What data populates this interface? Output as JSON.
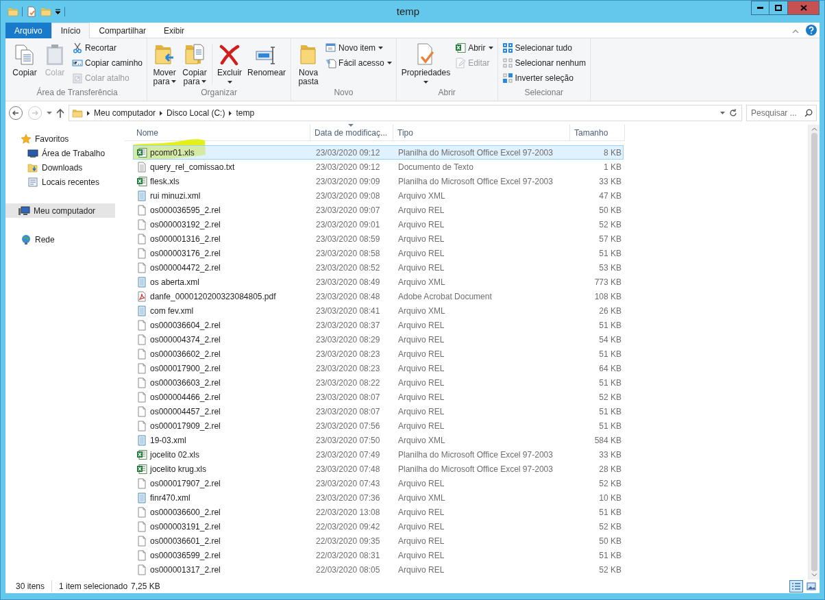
{
  "window": {
    "title": "temp"
  },
  "ribbon_tabs": [
    {
      "label": "Arquivo",
      "kind": "file",
      "selected": false
    },
    {
      "label": "Início",
      "kind": "tab",
      "selected": true
    },
    {
      "label": "Compartilhar",
      "kind": "tab",
      "selected": false
    },
    {
      "label": "Exibir",
      "kind": "tab",
      "selected": false
    }
  ],
  "ribbon_groups": [
    {
      "label": "Área de Transferência",
      "items": [
        {
          "label": "Copiar",
          "kind": "large",
          "disabled": false,
          "dropdown": false
        },
        {
          "label": "Colar",
          "kind": "large",
          "disabled": true,
          "dropdown": false
        },
        {
          "kind": "stack",
          "items": [
            {
              "label": "Recortar",
              "disabled": false,
              "dropdown": false
            },
            {
              "label": "Copiar caminho",
              "disabled": false,
              "dropdown": false
            },
            {
              "label": "Colar atalho",
              "disabled": true,
              "dropdown": false
            }
          ]
        }
      ]
    },
    {
      "label": "Organizar",
      "items": [
        {
          "label": "Mover para",
          "kind": "large",
          "disabled": false,
          "dropdown": true
        },
        {
          "label": "Copiar para",
          "kind": "large",
          "disabled": false,
          "dropdown": true
        },
        {
          "kind": "separator"
        },
        {
          "label": "Excluir",
          "kind": "split",
          "disabled": false,
          "dropdown": true
        },
        {
          "label": "Renomear",
          "kind": "large",
          "disabled": false,
          "dropdown": false
        }
      ]
    },
    {
      "label": "Novo",
      "items": [
        {
          "label": "Nova pasta",
          "kind": "large",
          "disabled": false,
          "dropdown": false
        },
        {
          "kind": "stack",
          "items": [
            {
              "label": "Novo item",
              "disabled": false,
              "dropdown": true
            },
            {
              "label": "Fácil acesso",
              "disabled": false,
              "dropdown": true
            }
          ]
        }
      ]
    },
    {
      "label": "Abrir",
      "items": [
        {
          "label": "Propriedades",
          "kind": "split",
          "disabled": false,
          "dropdown": true
        },
        {
          "kind": "stack",
          "items": [
            {
              "label": "Abrir",
              "disabled": false,
              "dropdown": true
            },
            {
              "label": "Editar",
              "disabled": true,
              "dropdown": false
            }
          ]
        }
      ]
    },
    {
      "label": "Selecionar",
      "items": [
        {
          "kind": "stack",
          "items": [
            {
              "label": "Selecionar tudo",
              "disabled": false,
              "dropdown": false
            },
            {
              "label": "Selecionar nenhum",
              "disabled": false,
              "dropdown": false
            },
            {
              "label": "Inverter seleção",
              "disabled": false,
              "dropdown": false
            }
          ]
        }
      ]
    }
  ],
  "address": {
    "breadcrumb": [
      "Meu computador",
      "Disco Local (C:)",
      "temp"
    ],
    "back_disabled": false,
    "forward_disabled": true
  },
  "search": {
    "placeholder": "Pesquisar ..."
  },
  "sidebar": {
    "items": [
      {
        "label": "Favoritos",
        "kind": "favorites",
        "selected": false,
        "children": [
          {
            "label": "Área de Trabalho",
            "kind": "desktop",
            "selected": false
          },
          {
            "label": "Downloads",
            "kind": "downloads",
            "selected": false
          },
          {
            "label": "Locais recentes",
            "kind": "recent",
            "selected": false
          }
        ]
      },
      {
        "label": "Meu computador",
        "kind": "computer",
        "selected": true
      },
      {
        "label": "Rede",
        "kind": "network",
        "selected": false
      }
    ]
  },
  "table": {
    "columns": [
      {
        "label": "Nome",
        "sorted": false
      },
      {
        "label": "Data de modificaç...",
        "sorted": true
      },
      {
        "label": "Tipo",
        "sorted": false
      },
      {
        "label": "Tamanho",
        "sorted": false
      }
    ],
    "rows": [
      {
        "name": "pcomr01.xls",
        "date": "23/03/2020 09:12",
        "type": "Planilha do Microsoft Office Excel 97-2003",
        "size": "8 KB",
        "kind": "excel",
        "selected": true,
        "highlighted": true
      },
      {
        "name": "query_rel_comissao.txt",
        "date": "23/03/2020 09:12",
        "type": "Documento de Texto",
        "size": "1 KB",
        "kind": "text",
        "selected": false,
        "highlighted": false
      },
      {
        "name": "flesk.xls",
        "date": "23/03/2020 09:09",
        "type": "Planilha do Microsoft Office Excel 97-2003",
        "size": "33 KB",
        "kind": "excel",
        "selected": false,
        "highlighted": false
      },
      {
        "name": "rui minuzi.xml",
        "date": "23/03/2020 09:08",
        "type": "Arquivo XML",
        "size": "47 KB",
        "kind": "xml",
        "selected": false,
        "highlighted": false
      },
      {
        "name": "os000036595_2.rel",
        "date": "23/03/2020 09:07",
        "type": "Arquivo REL",
        "size": "50 KB",
        "kind": "rel",
        "selected": false,
        "highlighted": false
      },
      {
        "name": "os000003192_2.rel",
        "date": "23/03/2020 09:01",
        "type": "Arquivo REL",
        "size": "52 KB",
        "kind": "rel",
        "selected": false,
        "highlighted": false
      },
      {
        "name": "os000001316_2.rel",
        "date": "23/03/2020 08:59",
        "type": "Arquivo REL",
        "size": "57 KB",
        "kind": "rel",
        "selected": false,
        "highlighted": false
      },
      {
        "name": "os000003176_2.rel",
        "date": "23/03/2020 08:58",
        "type": "Arquivo REL",
        "size": "51 KB",
        "kind": "rel",
        "selected": false,
        "highlighted": false
      },
      {
        "name": "os000004472_2.rel",
        "date": "23/03/2020 08:52",
        "type": "Arquivo REL",
        "size": "53 KB",
        "kind": "rel",
        "selected": false,
        "highlighted": false
      },
      {
        "name": "os aberta.xml",
        "date": "23/03/2020 08:49",
        "type": "Arquivo XML",
        "size": "773 KB",
        "kind": "xml",
        "selected": false,
        "highlighted": false
      },
      {
        "name": "danfe_0000120200323084805.pdf",
        "date": "23/03/2020 08:48",
        "type": "Adobe Acrobat Document",
        "size": "108 KB",
        "kind": "pdf",
        "selected": false,
        "highlighted": false
      },
      {
        "name": "com fev.xml",
        "date": "23/03/2020 08:41",
        "type": "Arquivo XML",
        "size": "26 KB",
        "kind": "xml",
        "selected": false,
        "highlighted": false
      },
      {
        "name": "os000036604_2.rel",
        "date": "23/03/2020 08:37",
        "type": "Arquivo REL",
        "size": "51 KB",
        "kind": "rel",
        "selected": false,
        "highlighted": false
      },
      {
        "name": "os000004374_2.rel",
        "date": "23/03/2020 08:29",
        "type": "Arquivo REL",
        "size": "54 KB",
        "kind": "rel",
        "selected": false,
        "highlighted": false
      },
      {
        "name": "os000036602_2.rel",
        "date": "23/03/2020 08:23",
        "type": "Arquivo REL",
        "size": "51 KB",
        "kind": "rel",
        "selected": false,
        "highlighted": false
      },
      {
        "name": "os000017900_2.rel",
        "date": "23/03/2020 08:23",
        "type": "Arquivo REL",
        "size": "64 KB",
        "kind": "rel",
        "selected": false,
        "highlighted": false
      },
      {
        "name": "os000036603_2.rel",
        "date": "23/03/2020 08:22",
        "type": "Arquivo REL",
        "size": "51 KB",
        "kind": "rel",
        "selected": false,
        "highlighted": false
      },
      {
        "name": "os000004466_2.rel",
        "date": "23/03/2020 08:07",
        "type": "Arquivo REL",
        "size": "52 KB",
        "kind": "rel",
        "selected": false,
        "highlighted": false
      },
      {
        "name": "os000004457_2.rel",
        "date": "23/03/2020 08:07",
        "type": "Arquivo REL",
        "size": "51 KB",
        "kind": "rel",
        "selected": false,
        "highlighted": false
      },
      {
        "name": "os000017909_2.rel",
        "date": "23/03/2020 07:56",
        "type": "Arquivo REL",
        "size": "51 KB",
        "kind": "rel",
        "selected": false,
        "highlighted": false
      },
      {
        "name": "19-03.xml",
        "date": "23/03/2020 07:50",
        "type": "Arquivo XML",
        "size": "584 KB",
        "kind": "xml",
        "selected": false,
        "highlighted": false
      },
      {
        "name": "jocelito 02.xls",
        "date": "23/03/2020 07:49",
        "type": "Planilha do Microsoft Office Excel 97-2003",
        "size": "33 KB",
        "kind": "excel",
        "selected": false,
        "highlighted": false
      },
      {
        "name": "jocelito krug.xls",
        "date": "23/03/2020 07:48",
        "type": "Planilha do Microsoft Office Excel 97-2003",
        "size": "28 KB",
        "kind": "excel",
        "selected": false,
        "highlighted": false
      },
      {
        "name": "os000017907_2.rel",
        "date": "23/03/2020 07:43",
        "type": "Arquivo REL",
        "size": "52 KB",
        "kind": "rel",
        "selected": false,
        "highlighted": false
      },
      {
        "name": "finr470.xml",
        "date": "23/03/2020 07:36",
        "type": "Arquivo XML",
        "size": "10 KB",
        "kind": "xml",
        "selected": false,
        "highlighted": false
      },
      {
        "name": "os000036600_2.rel",
        "date": "22/03/2020 13:08",
        "type": "Arquivo REL",
        "size": "51 KB",
        "kind": "rel",
        "selected": false,
        "highlighted": false
      },
      {
        "name": "os000003191_2.rel",
        "date": "22/03/2020 09:42",
        "type": "Arquivo REL",
        "size": "52 KB",
        "kind": "rel",
        "selected": false,
        "highlighted": false
      },
      {
        "name": "os000036601_2.rel",
        "date": "22/03/2020 09:35",
        "type": "Arquivo REL",
        "size": "50 KB",
        "kind": "rel",
        "selected": false,
        "highlighted": false
      },
      {
        "name": "os000036599_2.rel",
        "date": "22/03/2020 08:31",
        "type": "Arquivo REL",
        "size": "51 KB",
        "kind": "rel",
        "selected": false,
        "highlighted": false
      },
      {
        "name": "os000001317_2.rel",
        "date": "22/03/2020 08:05",
        "type": "Arquivo REL",
        "size": "52 KB",
        "kind": "rel",
        "selected": false,
        "highlighted": false
      }
    ]
  },
  "status_bar": {
    "count": "30 itens",
    "selection": "1 item selecionado",
    "selection_size": "7,25 KB",
    "views": [
      {
        "kind": "details",
        "selected": true
      },
      {
        "kind": "tiles",
        "selected": false
      }
    ]
  }
}
